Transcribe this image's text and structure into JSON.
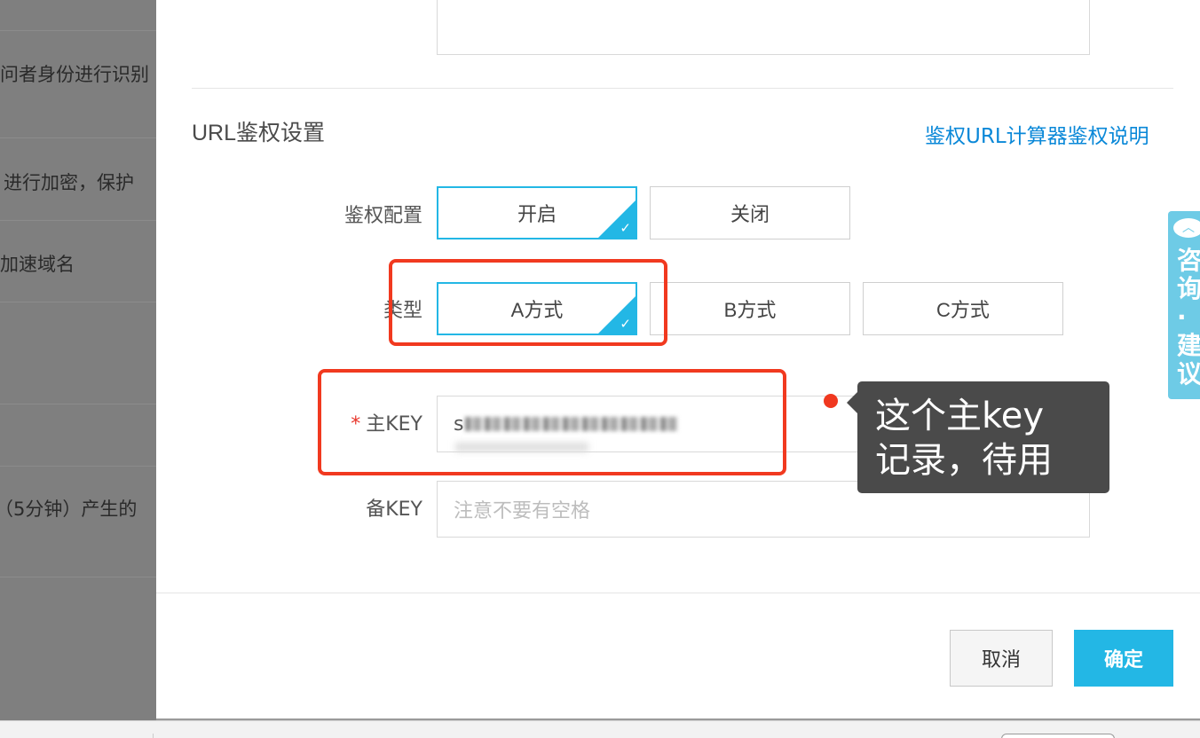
{
  "background_page": {
    "rows": [
      "问者身份进行识别",
      "进行加密，保护",
      "加速域名",
      "（5分钟）产生的"
    ]
  },
  "section": {
    "title": "URL鉴权设置",
    "links": [
      "鉴权URL计算器",
      "鉴权说明"
    ]
  },
  "auth_config": {
    "label": "鉴权配置",
    "options": [
      "开启",
      "关闭"
    ],
    "selected": "开启"
  },
  "auth_type": {
    "label": "类型",
    "options": [
      "A方式",
      "B方式",
      "C方式"
    ],
    "selected": "A方式"
  },
  "primary_key": {
    "required_mark": "*",
    "label": "主KEY",
    "value_visible_prefix": "s"
  },
  "backup_key": {
    "label": "备KEY",
    "placeholder": "注意不要有空格"
  },
  "annotation": {
    "line1": "这个主key",
    "line2": "记录，待用"
  },
  "footer": {
    "cancel_label": "取消",
    "ok_label": "确定"
  },
  "consult_tab": {
    "text": "咨询·建议"
  },
  "colors": {
    "accent": "#23b7e5",
    "link": "#0a88d8",
    "highlight_red": "#f1391f"
  }
}
